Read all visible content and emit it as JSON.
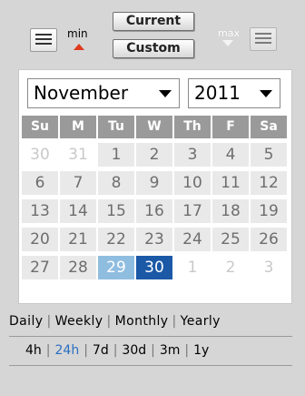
{
  "toolbar": {
    "min_label": "min",
    "max_label": "max",
    "current_label": "Current",
    "custom_label": "Custom"
  },
  "calendar": {
    "month": "November",
    "year": "2011",
    "weekdays": [
      "Su",
      "M",
      "Tu",
      "W",
      "Th",
      "F",
      "Sa"
    ],
    "weeks": [
      [
        "30",
        "31",
        "1",
        "2",
        "3",
        "4",
        "5"
      ],
      [
        "6",
        "7",
        "8",
        "9",
        "10",
        "11",
        "12"
      ],
      [
        "13",
        "14",
        "15",
        "16",
        "17",
        "18",
        "19"
      ],
      [
        "20",
        "21",
        "22",
        "23",
        "24",
        "25",
        "26"
      ],
      [
        "27",
        "28",
        "29",
        "30",
        "1",
        "2",
        "3"
      ]
    ],
    "colors": {
      "header_bg": "#9a9a9a",
      "day_bg": "#e9e9e9",
      "range_start_bg": "#8fbde0",
      "selected_bg": "#1b59a7"
    }
  },
  "periods": [
    "Daily",
    "Weekly",
    "Monthly",
    "Yearly"
  ],
  "ranges": [
    "4h",
    "24h",
    "7d",
    "30d",
    "3m",
    "1y"
  ],
  "active_range": "24h"
}
